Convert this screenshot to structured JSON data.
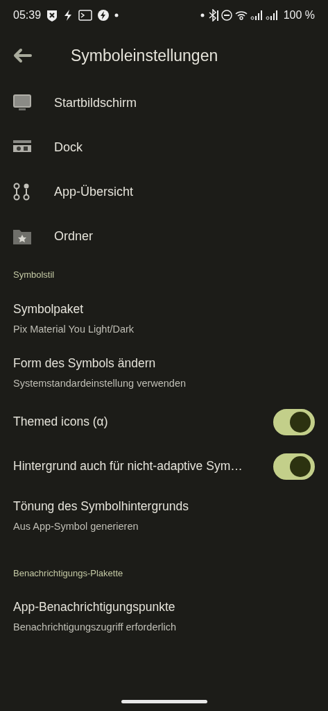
{
  "status_bar": {
    "time": "05:39",
    "battery": "100 %"
  },
  "title": "Symboleinstellungen",
  "nav_items": [
    {
      "label": "Startbildschirm"
    },
    {
      "label": "Dock"
    },
    {
      "label": "App-Übersicht"
    },
    {
      "label": "Ordner"
    }
  ],
  "sections": [
    {
      "header": "Symbolstil",
      "items": [
        {
          "kind": "text",
          "title": "Symbolpaket",
          "summary": "Pix Material You Light/Dark"
        },
        {
          "kind": "text",
          "title": "Form des Symbols ändern",
          "summary": "Systemstandardeinstellung verwenden"
        },
        {
          "kind": "switch",
          "title": "Themed icons (α)",
          "on": true
        },
        {
          "kind": "switch",
          "title": "Hintergrund auch für nicht-adaptive Sym…",
          "on": true
        },
        {
          "kind": "text",
          "title": "Tönung des Symbolhintergrunds",
          "summary": "Aus App-Symbol generieren"
        }
      ]
    },
    {
      "header": "Benachrichtigungs-Plakette",
      "items": [
        {
          "kind": "text",
          "title": "App-Benachrichtigungspunkte",
          "summary": "Benachrichtigungszugriff erforderlich"
        }
      ]
    }
  ]
}
